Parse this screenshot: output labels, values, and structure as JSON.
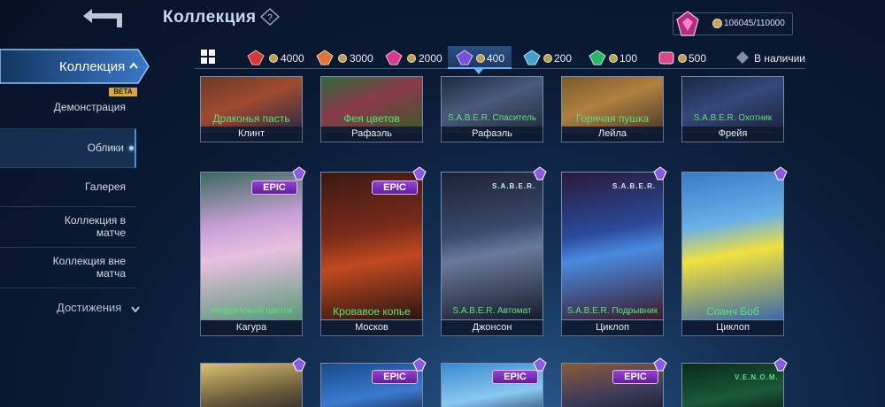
{
  "header": {
    "title": "Коллекция",
    "points": "106045/110000"
  },
  "sidebar": {
    "active": "Коллекция",
    "beta": "BETA",
    "items": [
      "Демонстрация",
      "Облики",
      "Галерея",
      "Коллекция в матче",
      "Коллекция вне матча"
    ],
    "selected_index": 1,
    "achievements": "Достижения"
  },
  "filters": {
    "tabs": [
      {
        "value": "4000",
        "color": "#d23b3b"
      },
      {
        "value": "3000",
        "color": "#e0733a"
      },
      {
        "value": "2000",
        "color": "#d83a8c"
      },
      {
        "value": "400",
        "color": "#7a52d8"
      },
      {
        "value": "200",
        "color": "#43a0c8"
      },
      {
        "value": "100",
        "color": "#2db36a"
      },
      {
        "value": "500",
        "color": "#d84a8a"
      }
    ],
    "selected_index": 3,
    "available_label": "В наличии"
  },
  "cards": {
    "row1": [
      {
        "skin": "Драконья пасть",
        "hero": "Клинт"
      },
      {
        "skin": "Фея цветов",
        "hero": "Рафаэль"
      },
      {
        "skin": "S.A.B.E.R. Спаситель",
        "hero": "Рафаэль"
      },
      {
        "skin": "Горячая пушка",
        "hero": "Лейла"
      },
      {
        "skin": "S.A.B.E.R. Охотник",
        "hero": "Фрейя"
      }
    ],
    "row2": [
      {
        "skin": "Нефритовый цветок",
        "hero": "Кагура",
        "badge": "EPIC"
      },
      {
        "skin": "Кровавое копье",
        "hero": "Москов",
        "badge": "EPIC"
      },
      {
        "skin": "S.A.B.E.R. Автомат",
        "hero": "Джонсон",
        "brand": "S.A.B.E.R."
      },
      {
        "skin": "S.A.B.E.R. Подрывник",
        "hero": "Циклоп",
        "brand": "S.A.B.E.R."
      },
      {
        "skin": "Спанч Боб",
        "hero": "Циклоп"
      }
    ],
    "row3_badges": [
      "",
      "EPIC",
      "EPIC",
      "EPIC",
      "V.E.N.O.M."
    ]
  },
  "colors": {
    "skin_name": "#5fe07a",
    "epic": "#8a36cc",
    "accent": "#69b4ff"
  }
}
